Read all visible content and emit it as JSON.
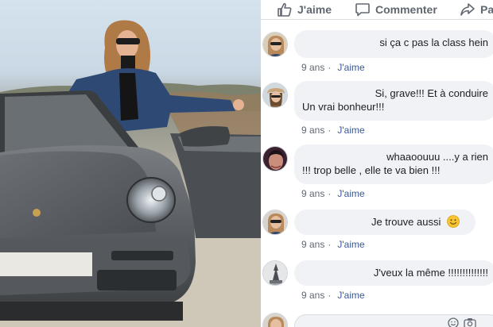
{
  "actions": {
    "like": "J'aime",
    "comment": "Commenter",
    "share": "Pa"
  },
  "comments": [
    {
      "lines": [
        "si ça c pas la class hein"
      ],
      "time": "9 ans",
      "like": "J'aime"
    },
    {
      "lines": [
        "Si, grave!!! Et à conduire",
        "Un vrai bonheur!!!"
      ],
      "time": "9 ans",
      "like": "J'aime"
    },
    {
      "lines": [
        "whaaoouuu ....y a rien",
        "!!! trop belle , elle te va bien !!!"
      ],
      "time": "9 ans",
      "like": "J'aime"
    },
    {
      "lines": [
        "Je trouve aussi"
      ],
      "emoji": "smiley",
      "time": "9 ans",
      "like": "J'aime"
    },
    {
      "lines": [
        "J'veux la même !!!!!!!!!!!!!!"
      ],
      "time": "9 ans",
      "like": "J'aime"
    }
  ],
  "icons": {
    "like": "thumbs-up-icon",
    "comment": "speech-bubble-icon",
    "share": "share-arrow-icon",
    "reply": [
      "emoji-icon",
      "camera-icon"
    ]
  },
  "colors": {
    "text_primary": "#1c1e21",
    "text_secondary": "#606770",
    "link": "#385898",
    "bubble": "#f0f2f5",
    "car": "#5b5f63"
  }
}
